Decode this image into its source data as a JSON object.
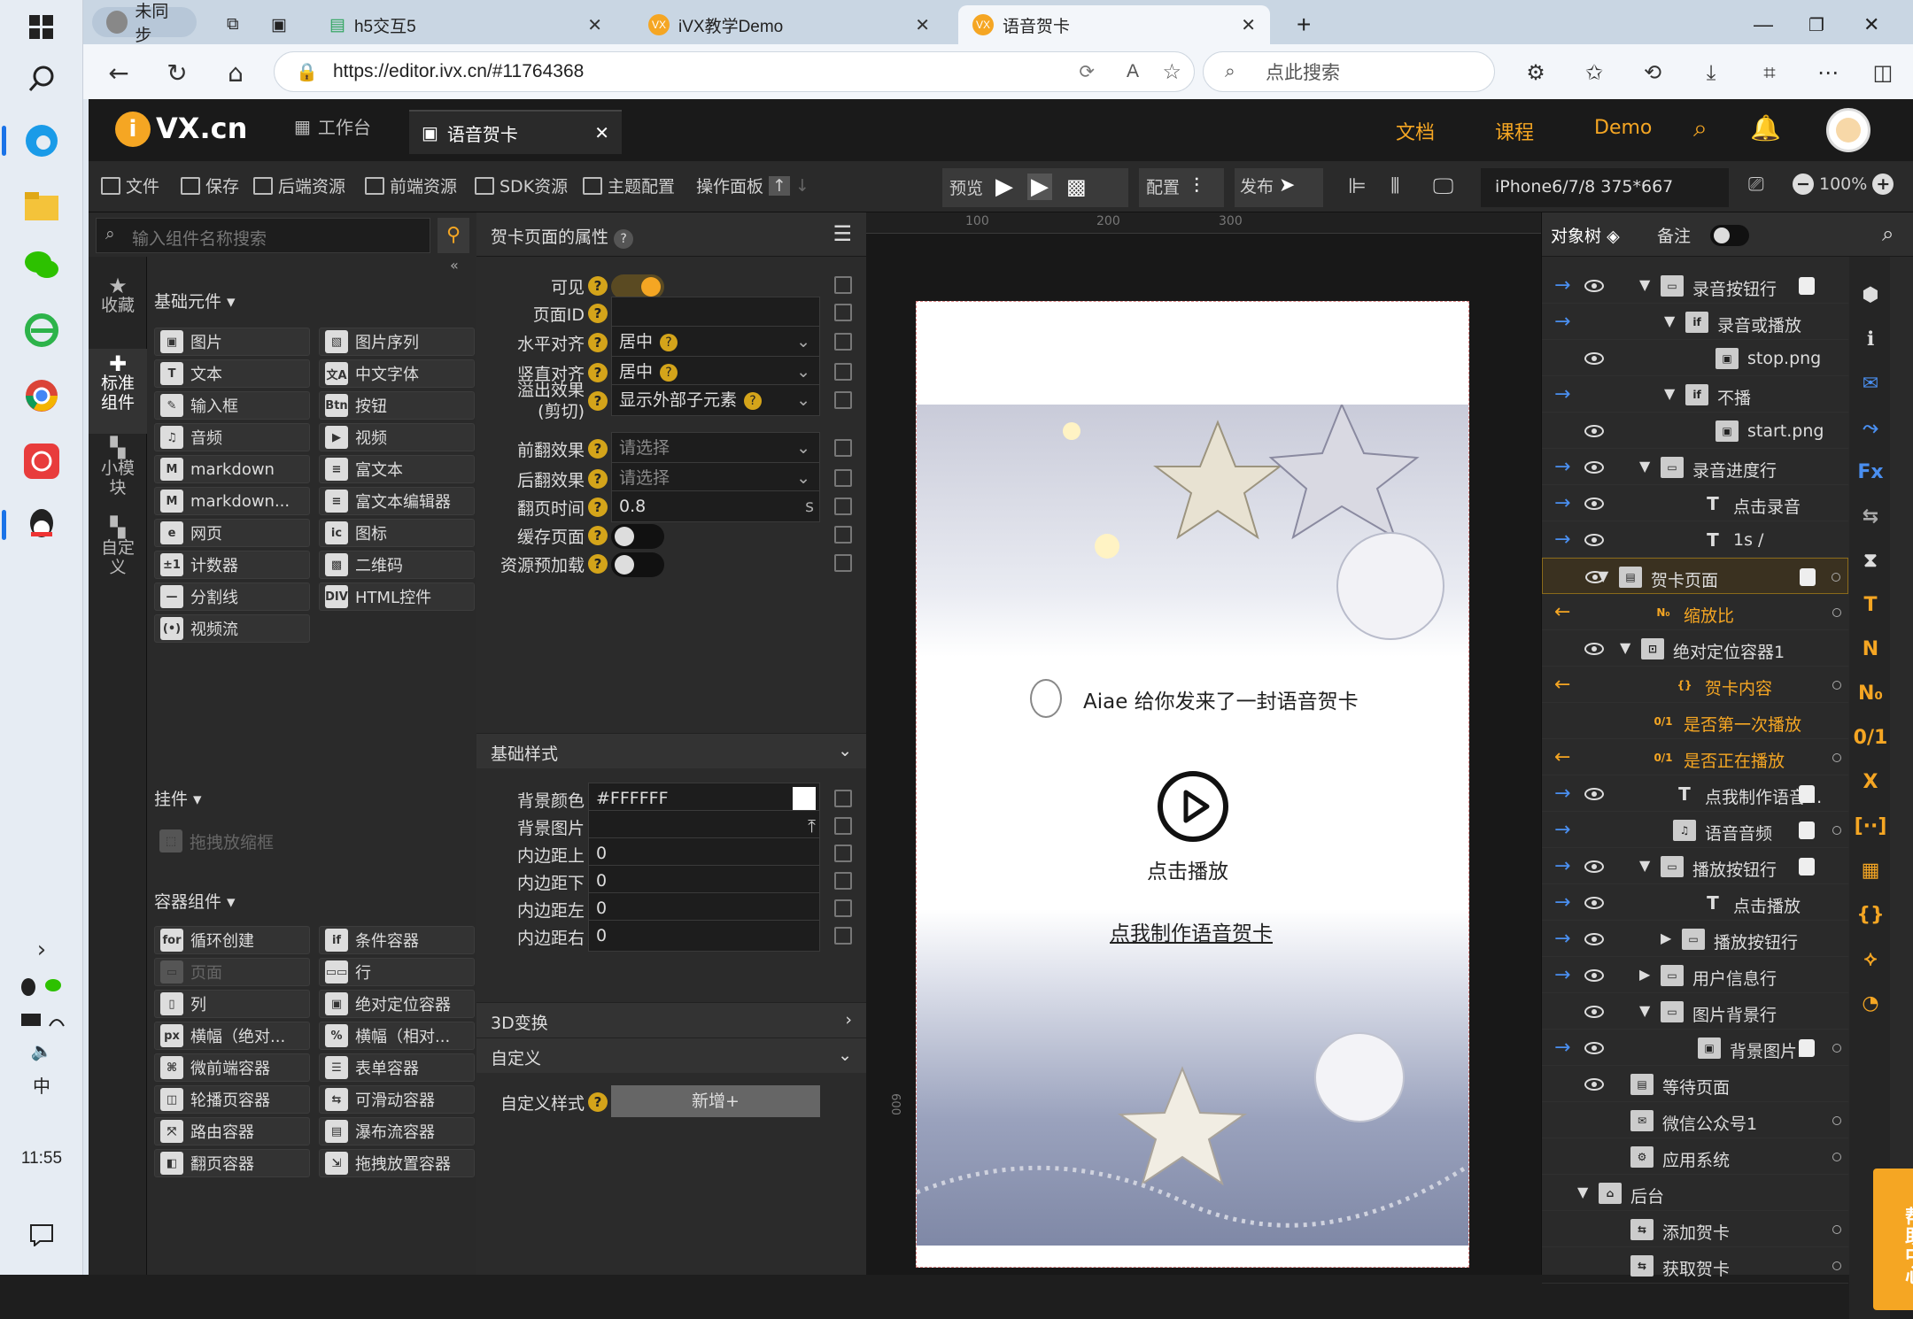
{
  "taskbar": {
    "clock": "11:55"
  },
  "browser": {
    "profile": "未同步",
    "tabs": [
      {
        "label": "h5交互5"
      },
      {
        "label": "iVX教学Demo"
      },
      {
        "label": "语音贺卡"
      }
    ],
    "url": "https://editor.ivx.cn/#11764368",
    "search_placeholder": "点此搜索"
  },
  "app": {
    "logo": "VX.cn",
    "workspace_tab": "工作台",
    "doc_tab": "语音贺卡",
    "nav": {
      "docs": "文档",
      "courses": "课程",
      "demo": "Demo"
    },
    "toolbar": {
      "file": "文件",
      "save": "保存",
      "backend": "后端资源",
      "frontend": "前端资源",
      "sdk": "SDK资源",
      "theme": "主题配置",
      "oppanel": "操作面板",
      "preview": "预览",
      "config": "配置",
      "publish": "发布",
      "device": "iPhone6/7/8 375*667",
      "zoom": "100%"
    }
  },
  "left": {
    "search_placeholder": "输入组件名称搜索",
    "vtabs": [
      "收藏",
      "标准组件",
      "小模块",
      "自定义"
    ],
    "groups": {
      "basic": "基础元件",
      "widget": "挂件",
      "container": "容器组件"
    },
    "basic": [
      "图片",
      "图片序列",
      "文本",
      "中文字体",
      "输入框",
      "按钮",
      "音频",
      "视频",
      "markdown",
      "富文本",
      "markdown...",
      "富文本编辑器",
      "网页",
      "图标",
      "计数器",
      "二维码",
      "分割线",
      "HTML控件",
      "视频流"
    ],
    "widget": [
      "拖拽放缩框"
    ],
    "container": [
      "循环创建",
      "条件容器",
      "页面",
      "行",
      "列",
      "绝对定位容器",
      "横幅（绝对...",
      "横幅（相对...",
      "微前端容器",
      "表单容器",
      "轮播页容器",
      "可滑动容器",
      "路由容器",
      "瀑布流容器",
      "翻页容器",
      "拖拽放置容器"
    ]
  },
  "props": {
    "title": "贺卡页面的属性",
    "rows": [
      {
        "label": "可见"
      },
      {
        "label": "页面ID",
        "value": ""
      },
      {
        "label": "水平对齐",
        "value": "居中"
      },
      {
        "label": "竖直对齐",
        "value": "居中"
      },
      {
        "label": "溢出效果",
        "label2": "(剪切)",
        "value": "显示外部子元素"
      },
      {
        "label": "前翻效果",
        "value": "请选择"
      },
      {
        "label": "后翻效果",
        "value": "请选择"
      },
      {
        "label": "翻页时间",
        "value": "0.8",
        "unit": "s"
      },
      {
        "label": "缓存页面"
      },
      {
        "label": "资源预加载"
      }
    ],
    "style_section": "基础样式",
    "style": [
      {
        "label": "背景颜色",
        "value": "#FFFFFF"
      },
      {
        "label": "背景图片",
        "value": ""
      },
      {
        "label": "内边距上",
        "value": "0"
      },
      {
        "label": "内边距下",
        "value": "0"
      },
      {
        "label": "内边距左",
        "value": "0"
      },
      {
        "label": "内边距右",
        "value": "0"
      }
    ],
    "section_3d": "3D变换",
    "section_custom": "自定义",
    "custom_style_label": "自定义样式",
    "add_button": "新增+"
  },
  "canvas": {
    "ruler": [
      "100",
      "200",
      "300"
    ],
    "ruler_side": "600",
    "greeting": "Aiae 给你发来了一封语音贺卡",
    "play_label": "点击播放",
    "make_link": "点我制作语音贺卡"
  },
  "tree": {
    "tab_objects": "对象树",
    "tab_notes": "备注",
    "rows": [
      {
        "label": "录音按钮行",
        "icon": "row"
      },
      {
        "label": "录音或播放",
        "icon": "if"
      },
      {
        "label": "stop.png",
        "icon": "image"
      },
      {
        "label": "不播",
        "icon": "if"
      },
      {
        "label": "start.png",
        "icon": "image"
      },
      {
        "label": "录音进度行",
        "icon": "row"
      },
      {
        "label": "点击录音",
        "icon": "text"
      },
      {
        "label": "1s /",
        "icon": "text"
      },
      {
        "label": "贺卡页面",
        "icon": "page"
      },
      {
        "label": "缩放比",
        "icon": "number"
      },
      {
        "label": "绝对定位容器1",
        "icon": "abs"
      },
      {
        "label": "贺卡内容",
        "icon": "object"
      },
      {
        "label": "是否第一次播放",
        "icon": "bool"
      },
      {
        "label": "是否正在播放",
        "icon": "bool"
      },
      {
        "label": "点我制作语音...",
        "icon": "text"
      },
      {
        "label": "语音音频",
        "icon": "audio"
      },
      {
        "label": "播放按钮行",
        "icon": "row"
      },
      {
        "label": "点击播放",
        "icon": "text"
      },
      {
        "label": "播放按钮行",
        "icon": "row"
      },
      {
        "label": "用户信息行",
        "icon": "row"
      },
      {
        "label": "图片背景行",
        "icon": "row"
      },
      {
        "label": "背景图片...",
        "icon": "image"
      },
      {
        "label": "等待页面",
        "icon": "page"
      },
      {
        "label": "微信公众号1",
        "icon": "wechat"
      },
      {
        "label": "应用系统",
        "icon": "gear"
      },
      {
        "label": "后台",
        "icon": "backend"
      },
      {
        "label": "添加贺卡",
        "icon": "api"
      },
      {
        "label": "获取贺卡",
        "icon": "api"
      }
    ],
    "help": "帮助中心"
  }
}
